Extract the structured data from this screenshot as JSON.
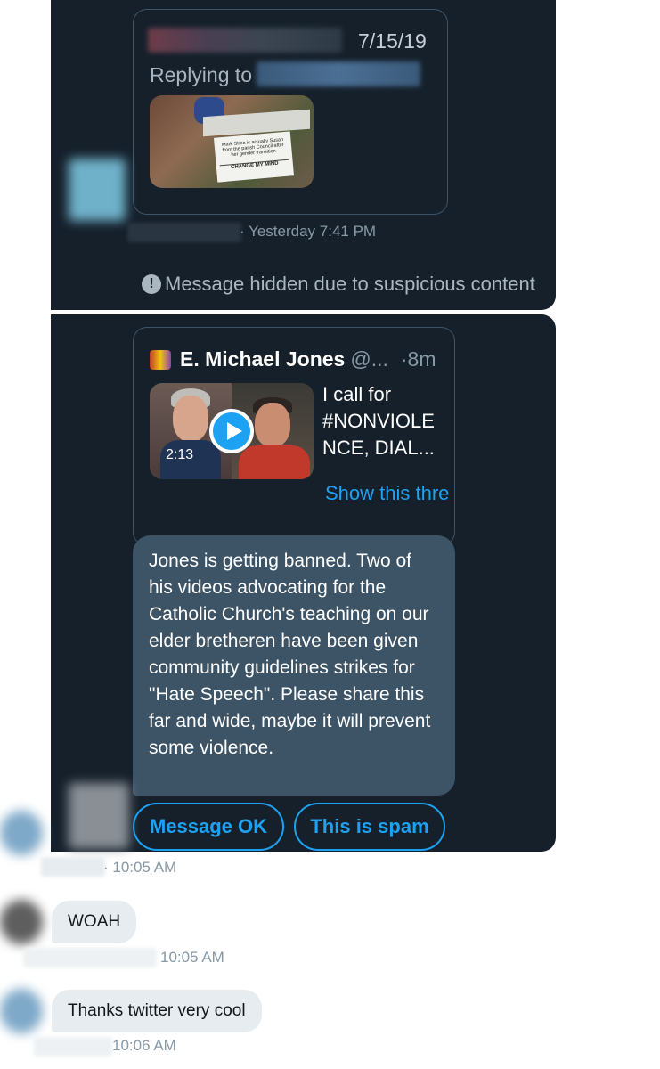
{
  "conversation": {
    "hidden_message": {
      "quoted": {
        "date": "7/15/19",
        "replying_label": "Replying to",
        "image_sign_text": "Mark Shea is actually Susan from the parish Council after her gender transition",
        "image_sign_caption": "CHANGE MY MIND"
      },
      "timestamp": "· Yesterday 7:41 PM",
      "notice": "Message hidden due to suspicious content",
      "notice_icon": "info-circle-icon"
    },
    "flagged_message": {
      "tweet": {
        "author": "E. Michael Jones",
        "handle": "@...",
        "time": "·8m",
        "video_duration": "2:13",
        "text": "I call for #NONVIOLE NCE, DIAL...",
        "show_thread": "Show this thre"
      },
      "body": "Jones is getting banned. Two of his videos advocating for the Catholic Church's teaching on our elder bretheren have been given community guidelines strikes for \"Hate Speech\". Please share this far and wide, maybe it will prevent some violence.",
      "actions": {
        "ok_label": "Message OK",
        "spam_label": "This is spam"
      },
      "timestamp": "· 10:05 AM"
    },
    "messages": [
      {
        "text": "WOAH",
        "timestamp": "10:05 AM"
      },
      {
        "text": "Thanks twitter very cool",
        "timestamp": "10:06 AM"
      }
    ],
    "colors": {
      "dark_panel": "#15202b",
      "accent": "#1da1f2",
      "bubble_dark": "#3d5466",
      "bubble_light": "#e6ecf0"
    }
  }
}
